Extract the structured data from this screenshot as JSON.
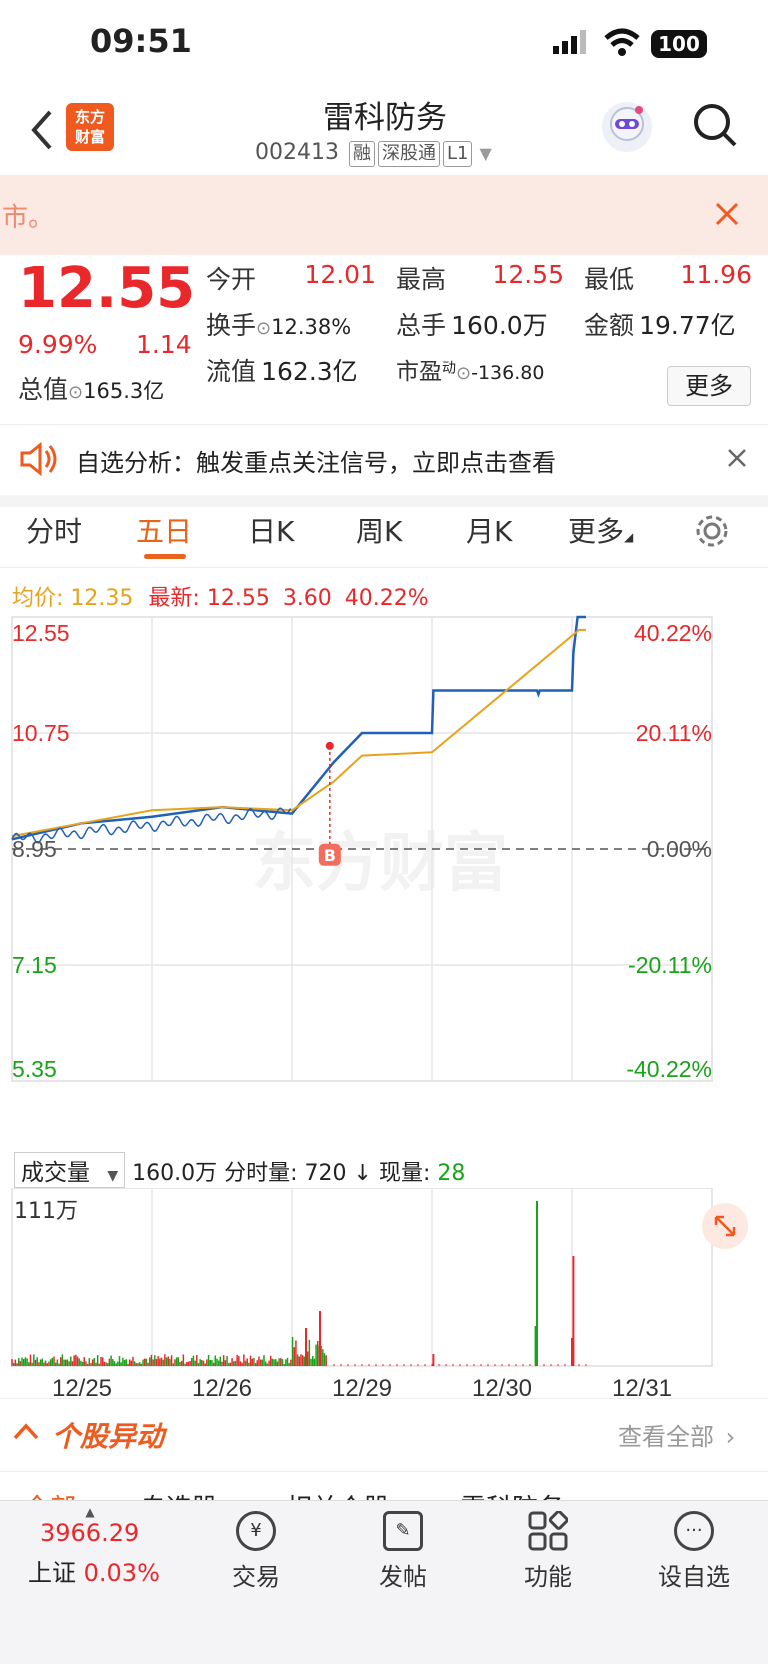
{
  "status_bar": {
    "time": "09:51",
    "battery": "100"
  },
  "header": {
    "logo_text": "东方\n财富",
    "stock_name": "雷科防务",
    "stock_code": "002413",
    "tags": [
      "融",
      "深股通",
      "L1"
    ]
  },
  "banner": {
    "text": "市。"
  },
  "quote": {
    "price": "12.55",
    "change_pct": "9.99%",
    "change_amt": "1.14",
    "open_label": "今开",
    "open_val": "12.01",
    "high_label": "最高",
    "high_val": "12.55",
    "low_label": "最低",
    "low_val": "11.96",
    "turnover_label": "换手",
    "turnover_val": "12.38%",
    "volume_label": "总手",
    "volume_val": "160.0万",
    "amount_label": "金额",
    "amount_val": "19.77亿",
    "mktcap_label": "总值",
    "mktcap_val": "165.3亿",
    "float_label": "流值",
    "float_val": "162.3亿",
    "pe_label": "市盈",
    "pe_sup": "动",
    "pe_val": "-136.80",
    "more_button": "更多"
  },
  "notice": {
    "text": "自选分析：触发重点关注信号，立即点击查看"
  },
  "tabs": [
    "分时",
    "五日",
    "日K",
    "周K",
    "月K",
    "更多"
  ],
  "active_tab": "五日",
  "chart_info": {
    "avg_label": "均价:",
    "avg_val": "12.35",
    "latest_label": "最新:",
    "latest_val": "12.55",
    "latest_chg": "3.60",
    "latest_pct": "40.22%",
    "watermark": "东方财富",
    "buy_marker": "B"
  },
  "chart_data": {
    "type": "line",
    "title": "",
    "x_labels": [
      "12/25",
      "12/26",
      "12/29",
      "12/30",
      "12/31"
    ],
    "y_ticks_left": [
      "12.55",
      "10.75",
      "8.95",
      "7.15",
      "5.35"
    ],
    "y_ticks_right": [
      "40.22%",
      "20.11%",
      "0.00%",
      "-20.11%",
      "-40.22%"
    ],
    "ylim": [
      5.35,
      12.55
    ],
    "base_price": 8.95,
    "series": [
      {
        "name": "最新",
        "color": "#2060b8",
        "values": [
          [
            0,
            9.1
          ],
          [
            0.5,
            9.35
          ],
          [
            1,
            9.45
          ],
          [
            1.5,
            9.6
          ],
          [
            2,
            9.5
          ],
          [
            2.3,
            10.3
          ],
          [
            2.5,
            10.75
          ],
          [
            3,
            10.75
          ],
          [
            3.01,
            11.41
          ],
          [
            3.75,
            11.41
          ],
          [
            3.76,
            11.35
          ],
          [
            3.77,
            11.41
          ],
          [
            4,
            11.41
          ],
          [
            4.01,
            12.0
          ],
          [
            4.04,
            12.55
          ],
          [
            4.1,
            12.55
          ]
        ]
      },
      {
        "name": "均价",
        "color": "#e8a21c",
        "values": [
          [
            0,
            9.15
          ],
          [
            0.5,
            9.35
          ],
          [
            1,
            9.55
          ],
          [
            1.5,
            9.6
          ],
          [
            2,
            9.55
          ],
          [
            2.3,
            10.0
          ],
          [
            2.5,
            10.4
          ],
          [
            3,
            10.45
          ],
          [
            4.05,
            12.35
          ],
          [
            4.1,
            12.35
          ]
        ]
      }
    ]
  },
  "volume_panel": {
    "selector_label": "成交量",
    "total": "160.0万",
    "tick_label": "分时量:",
    "tick_val": "720",
    "now_label": "现量:",
    "now_val": "28",
    "max_label": "111万"
  },
  "movement": {
    "title": "个股异动",
    "view_all": "查看全部"
  },
  "sub_tabs": [
    "全部",
    "自选股",
    "相关个股",
    "雷科防务"
  ],
  "bottom_nav": {
    "index_val": "3966.29",
    "index_name": "上证",
    "index_pct": "0.03%",
    "items": [
      "交易",
      "发帖",
      "功能",
      "设自选"
    ]
  }
}
